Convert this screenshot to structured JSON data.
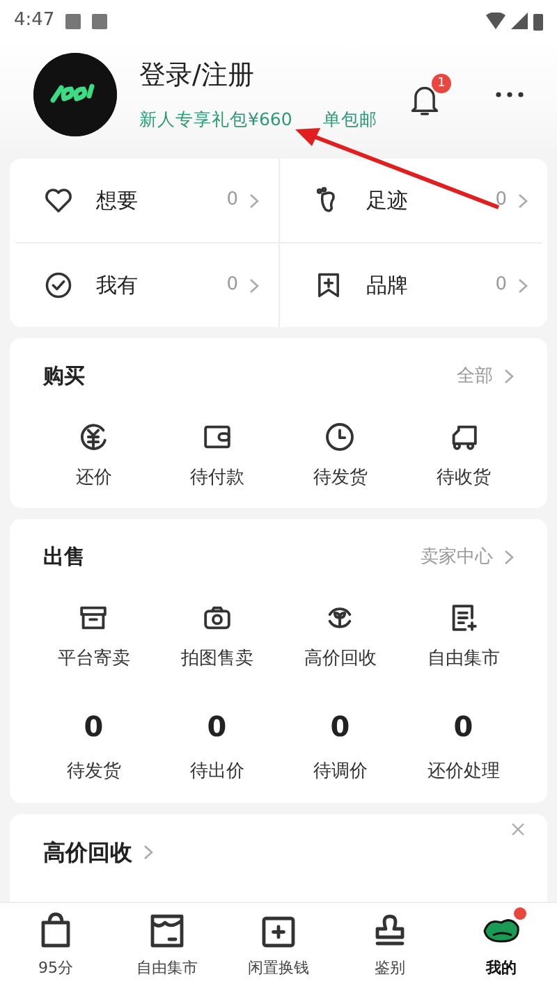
{
  "status_bar": {
    "time": "4:47"
  },
  "profile": {
    "title": "登录/注册",
    "promo": [
      "新人专享礼包¥660",
      "单包邮"
    ],
    "notification_count": "1"
  },
  "stats": [
    {
      "label": "想要",
      "count": "0"
    },
    {
      "label": "足迹",
      "count": "0"
    },
    {
      "label": "我有",
      "count": "0"
    },
    {
      "label": "品牌",
      "count": "0"
    }
  ],
  "buy": {
    "title": "购买",
    "link": "全部",
    "items": [
      {
        "label": "还价"
      },
      {
        "label": "待付款"
      },
      {
        "label": "待发货"
      },
      {
        "label": "待收货"
      }
    ]
  },
  "sell": {
    "title": "出售",
    "link": "卖家中心",
    "items": [
      {
        "label": "平台寄卖"
      },
      {
        "label": "拍图售卖"
      },
      {
        "label": "高价回收"
      },
      {
        "label": "自由集市"
      }
    ],
    "counts": [
      {
        "value": "0",
        "label": "待发货"
      },
      {
        "value": "0",
        "label": "待出价"
      },
      {
        "value": "0",
        "label": "待调价"
      },
      {
        "value": "0",
        "label": "还价处理"
      }
    ]
  },
  "recycle_banner": {
    "title": "高价回收"
  },
  "tab_bar": [
    {
      "label": "95分",
      "selected": false,
      "dot": false
    },
    {
      "label": "自由集市",
      "selected": false,
      "dot": false
    },
    {
      "label": "闲置换钱",
      "selected": false,
      "dot": false
    },
    {
      "label": "鉴别",
      "selected": false,
      "dot": false
    },
    {
      "label": "我的",
      "selected": true,
      "dot": true
    }
  ]
}
